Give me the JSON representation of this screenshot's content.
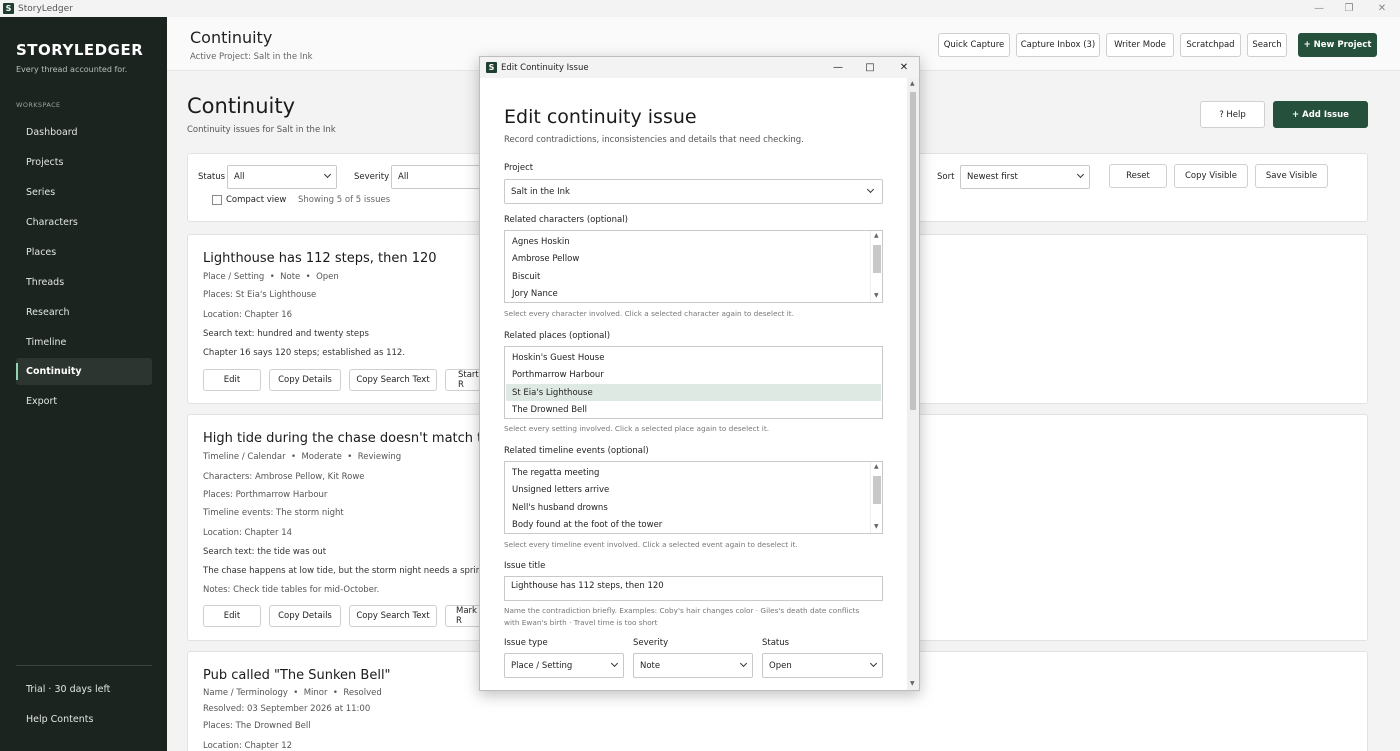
{
  "app": {
    "title": "StoryLedger",
    "icon_letter": "S",
    "window_controls": [
      "minimize-icon",
      "maximize-icon",
      "close-icon"
    ]
  },
  "sidebar": {
    "brand": "STORYLEDGER",
    "tagline": "Every thread accounted for.",
    "section": "WORKSPACE",
    "items": [
      {
        "label": "Dashboard"
      },
      {
        "label": "Projects"
      },
      {
        "label": "Series"
      },
      {
        "label": "Characters"
      },
      {
        "label": "Places"
      },
      {
        "label": "Threads"
      },
      {
        "label": "Research"
      },
      {
        "label": "Timeline"
      },
      {
        "label": "Continuity",
        "active": true
      },
      {
        "label": "Export"
      }
    ],
    "trial": "Trial · 30 days left",
    "help": "Help Contents"
  },
  "topbar": {
    "title": "Continuity",
    "subtitle": "Active Project: Salt in the Ink",
    "buttons": [
      "Quick Capture",
      "Capture Inbox (3)",
      "Writer Mode",
      "Scratchpad",
      "Search"
    ],
    "new_project": "+ New Project"
  },
  "page": {
    "title": "Continuity",
    "subtitle": "Continuity issues for Salt in the Ink",
    "help_button": "? Help",
    "add_button": "+ Add Issue"
  },
  "filters": {
    "status_label": "Status",
    "status_value": "All",
    "severity_label": "Severity",
    "severity_value": "All",
    "sort_label": "Sort",
    "sort_value": "Newest first",
    "reset": "Reset",
    "copy_visible": "Copy Visible",
    "save_visible": "Save Visible",
    "compact_view": "Compact view",
    "showing": "Showing 5 of 5 issues"
  },
  "issues": [
    {
      "title": "Lighthouse has 112 steps, then 120",
      "meta": [
        "Place / Setting",
        "Note",
        "Open"
      ],
      "lines": [
        "Places: St Eia's Lighthouse",
        "Location: Chapter 16",
        "Search text: hundred and twenty steps",
        "Chapter 16 says 120 steps; established as 112."
      ],
      "buttons": [
        "Edit",
        "Copy Details",
        "Copy Search Text",
        "Start R"
      ]
    },
    {
      "title": "High tide during the chase doesn't match the s",
      "meta": [
        "Timeline / Calendar",
        "Moderate",
        "Reviewing"
      ],
      "lines": [
        "Characters: Ambrose Pellow, Kit Rowe",
        "Places: Porthmarrow Harbour",
        "Timeline events: The storm night",
        "Location: Chapter 14",
        "Search text: the tide was out",
        "The chase happens at low tide, but the storm night needs a spring high",
        "Notes: Check tide tables for mid-October."
      ],
      "buttons": [
        "Edit",
        "Copy Details",
        "Copy Search Text",
        "Mark R"
      ]
    },
    {
      "title": "Pub called \"The Sunken Bell\"",
      "meta": [
        "Name / Terminology",
        "Minor",
        "Resolved"
      ],
      "lines": [
        "Resolved: 03 September 2026 at 11:00",
        "Places: The Drowned Bell",
        "Location: Chapter 12"
      ]
    }
  ],
  "dialog": {
    "window_title": "Edit Continuity Issue",
    "heading": "Edit continuity issue",
    "subheading": "Record contradictions, inconsistencies and details that need checking.",
    "project_label": "Project",
    "project_value": "Salt in the Ink",
    "characters_label": "Related characters (optional)",
    "characters": [
      "Agnes Hoskin",
      "Ambrose Pellow",
      "Biscuit",
      "Jory Nance"
    ],
    "characters_help": "Select every character involved. Click a selected character again to deselect it.",
    "places_label": "Related places (optional)",
    "places": [
      "Hoskin's Guest House",
      "Porthmarrow Harbour",
      "St Eia's Lighthouse",
      "The Drowned Bell"
    ],
    "places_selected": "St Eia's Lighthouse",
    "places_help": "Select every setting involved. Click a selected place again to deselect it.",
    "events_label": "Related timeline events (optional)",
    "events": [
      "The regatta meeting",
      "Unsigned letters arrive",
      "Nell's husband drowns",
      "Body found at the foot of the tower"
    ],
    "events_help": "Select every timeline event involved. Click a selected event again to deselect it.",
    "title_label": "Issue title",
    "title_value": "Lighthouse has 112 steps, then 120",
    "title_help": "Name the contradiction briefly. Examples: Coby's hair changes color · Giles's death date conflicts with Ewan's birth · Travel time is too short",
    "type_label": "Issue type",
    "type_value": "Place / Setting",
    "severity_label": "Severity",
    "severity_value": "Note",
    "status_label": "Status",
    "status_value": "Open"
  },
  "colors": {
    "sidebar_bg": "#1c2420",
    "accent": "#25503b",
    "selected_item": "#dfe9e3"
  }
}
